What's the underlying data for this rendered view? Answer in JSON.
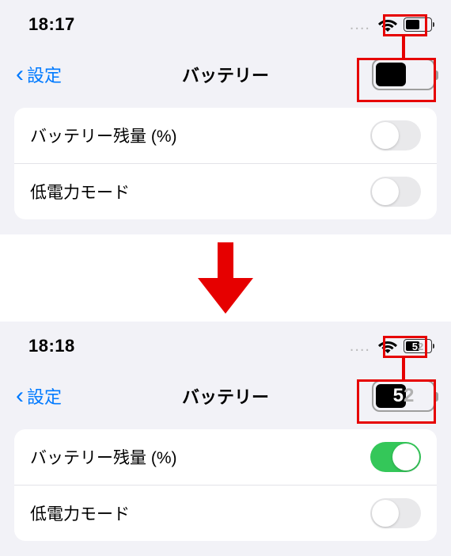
{
  "before": {
    "time": "18:17",
    "back_label": "設定",
    "title": "バッテリー",
    "battery_percent": 52,
    "rows": {
      "percentage_label": "バッテリー残量 (%)",
      "percentage_on": false,
      "lowpower_label": "低電力モード",
      "lowpower_on": false
    }
  },
  "after": {
    "time": "18:18",
    "back_label": "設定",
    "title": "バッテリー",
    "battery_percent": 52,
    "battery_text": "52",
    "rows": {
      "percentage_label": "バッテリー残量 (%)",
      "percentage_on": true,
      "lowpower_label": "低電力モード",
      "lowpower_on": false
    }
  },
  "colors": {
    "accent": "#007aff",
    "switch_on": "#34c759",
    "highlight": "#e60000"
  }
}
